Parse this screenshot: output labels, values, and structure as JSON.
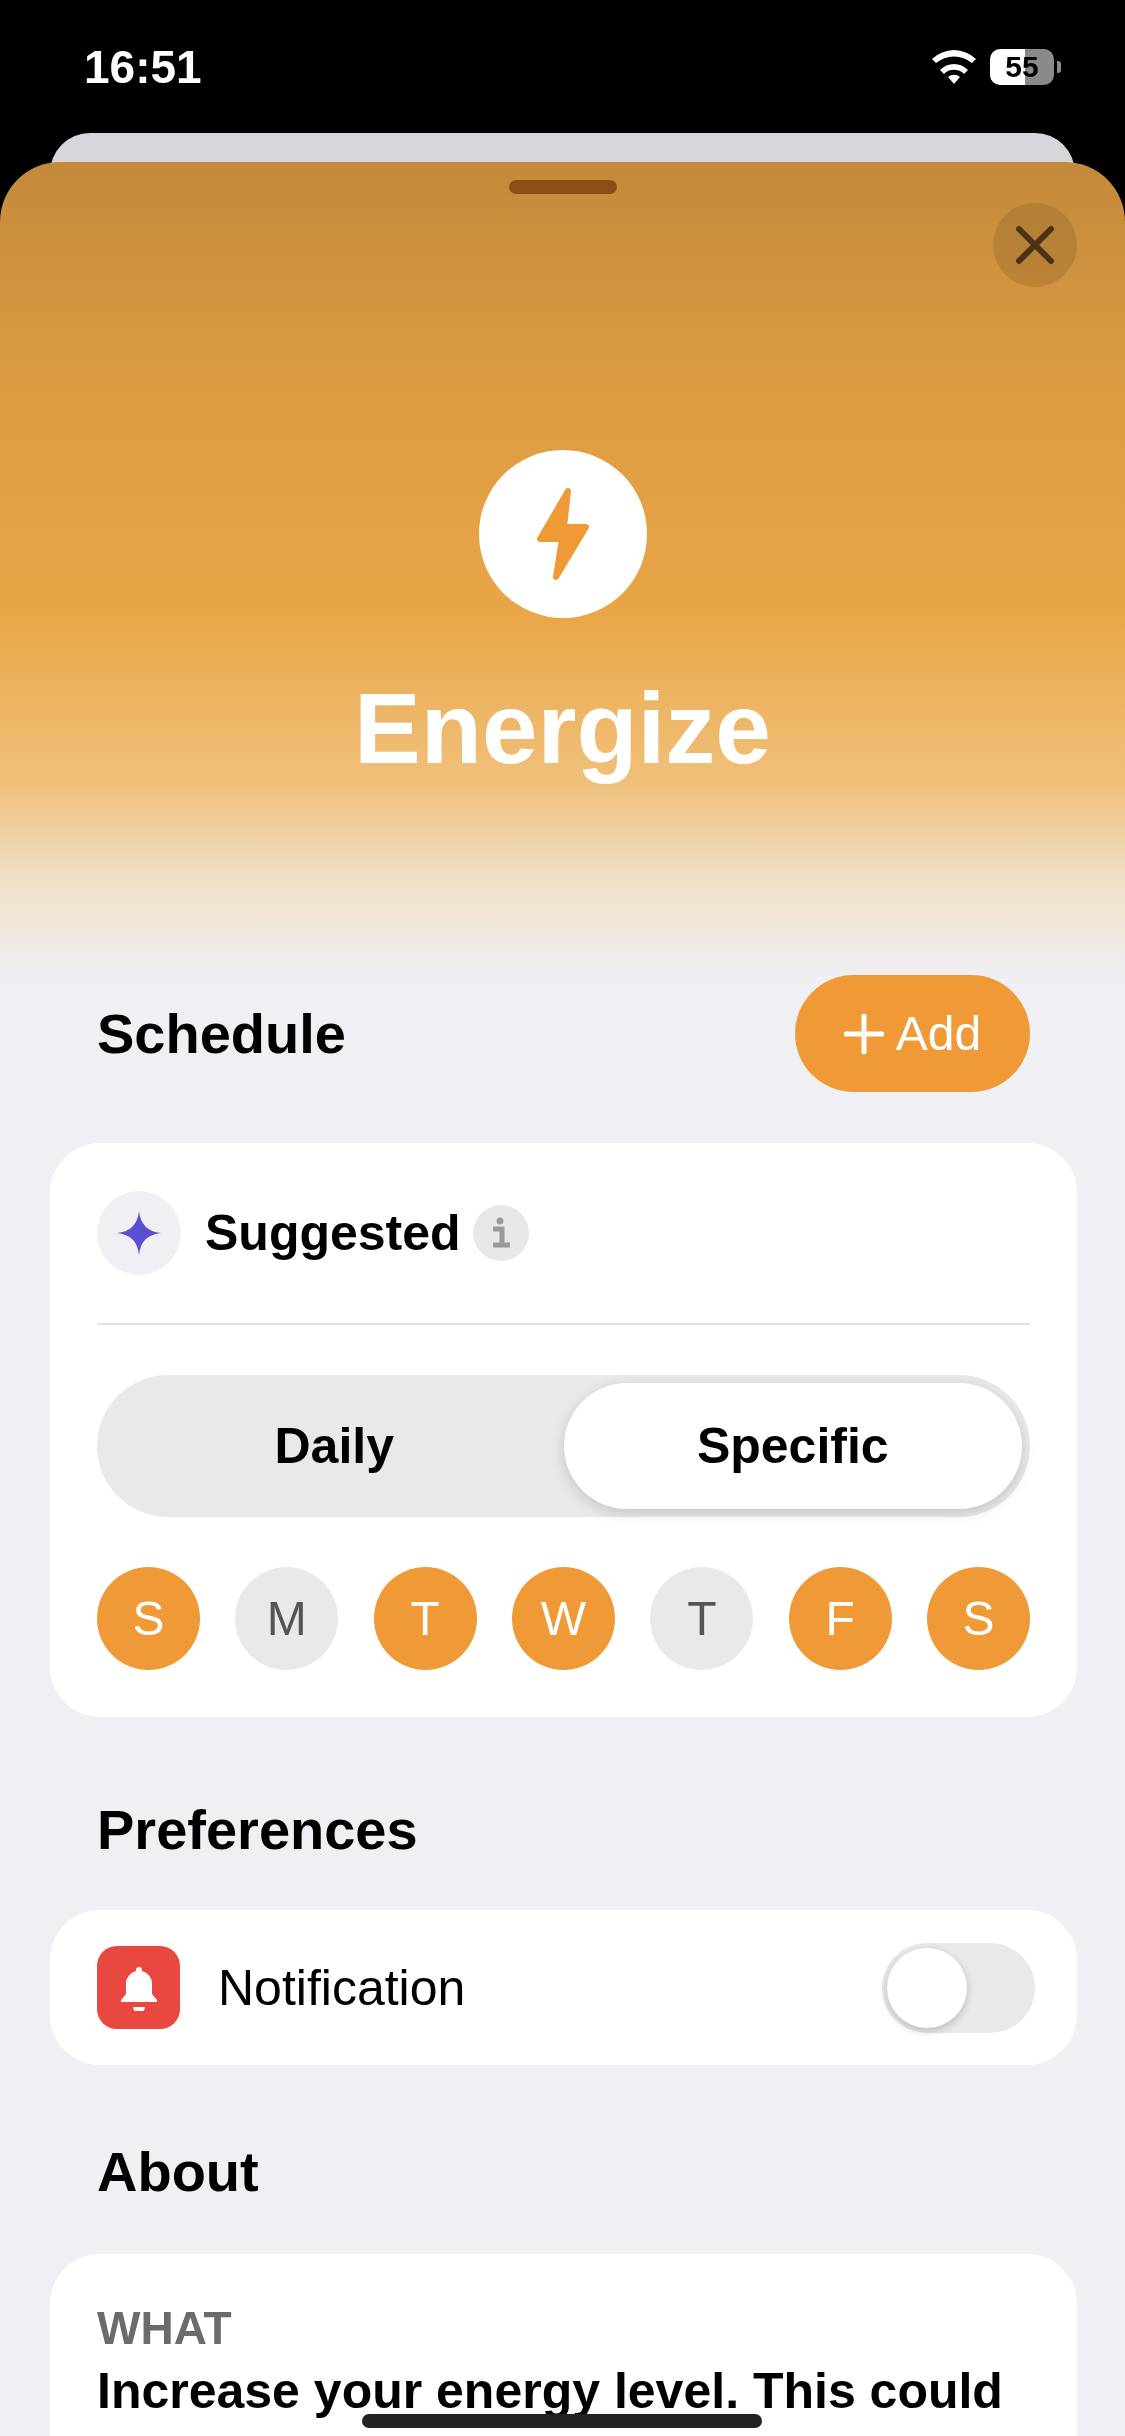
{
  "status_bar": {
    "time": "16:51",
    "battery": "55"
  },
  "header": {
    "title": "Energize"
  },
  "schedule": {
    "heading": "Schedule",
    "add_button": "Add",
    "suggested": "Suggested",
    "frequency": [
      {
        "label": "Daily",
        "selected": false
      },
      {
        "label": "Specific",
        "selected": true
      }
    ],
    "days": [
      {
        "label": "S",
        "selected": true
      },
      {
        "label": "M",
        "selected": false
      },
      {
        "label": "T",
        "selected": true
      },
      {
        "label": "W",
        "selected": true
      },
      {
        "label": "T",
        "selected": false
      },
      {
        "label": "F",
        "selected": true
      },
      {
        "label": "S",
        "selected": true
      }
    ]
  },
  "preferences": {
    "heading": "Preferences",
    "items": [
      {
        "label": "Notification",
        "on": false
      }
    ]
  },
  "about": {
    "heading": "About",
    "sections": [
      {
        "label": "WHAT",
        "text": "Increase your energy level. This could"
      }
    ]
  }
}
